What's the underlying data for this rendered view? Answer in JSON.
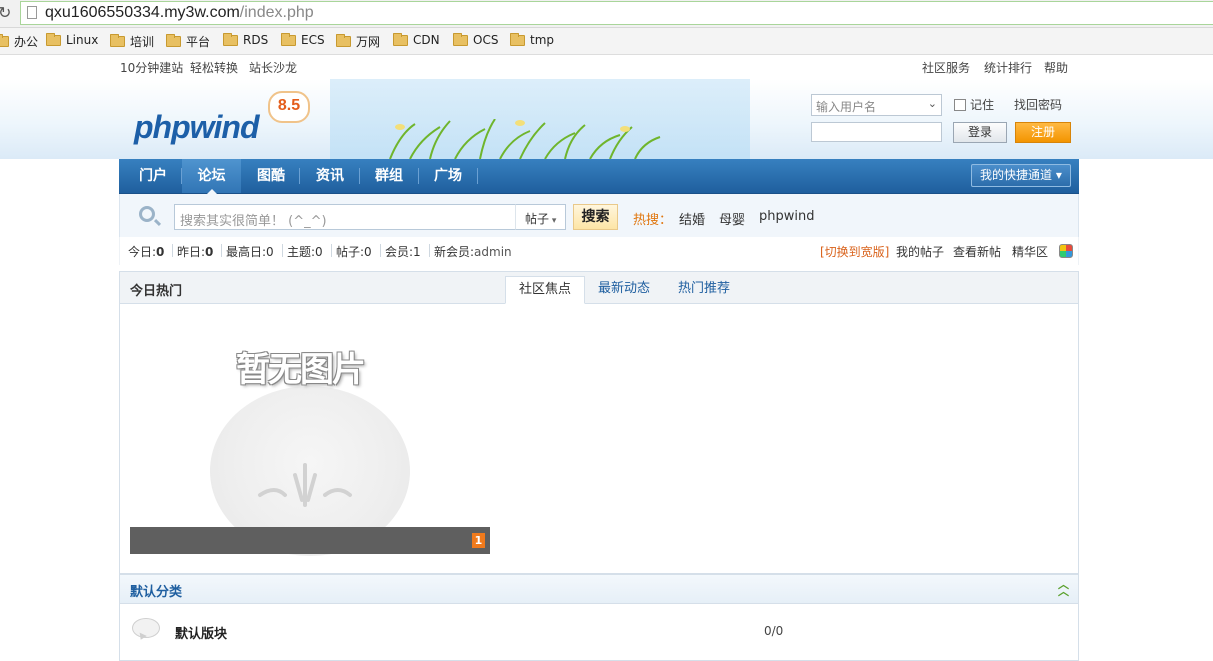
{
  "browser": {
    "url_host": "qxu1606550334.my3w.com",
    "url_path": "/index.php",
    "bookmarks": [
      "办公",
      "Linux",
      "培训",
      "平台",
      "RDS",
      "ECS",
      "万网",
      "CDN",
      "OCS",
      "tmp"
    ]
  },
  "toplinks": {
    "left": [
      "10分钟建站",
      "轻松转换",
      "站长沙龙"
    ],
    "right": [
      "社区服务",
      "统计排行",
      "帮助"
    ]
  },
  "header": {
    "logo": "phpwind",
    "version": "8.5",
    "login": {
      "user_placeholder": "输入用户名",
      "remember": "记住",
      "forgot": "找回密码",
      "login_btn": "登录",
      "register_btn": "注册"
    }
  },
  "nav": {
    "items": [
      "门户",
      "论坛",
      "图酷",
      "资讯",
      "群组",
      "广场"
    ],
    "active": "论坛",
    "quick": "我的快捷通道 ▾"
  },
  "search": {
    "placeholder": "搜索其实很简单！ (^_^)",
    "type": "帖子",
    "button": "搜索",
    "hot_label": "热搜：",
    "hot_items": [
      "结婚",
      "母婴",
      "phpwind"
    ]
  },
  "stats": {
    "today_label": "今日:",
    "today": "0",
    "yesterday_label": "昨日:",
    "yesterday": "0",
    "max_label": "最高日:",
    "max": "0",
    "topics_label": "主题:",
    "topics": "0",
    "posts_label": "帖子:",
    "posts": "0",
    "members_label": "会员:",
    "members": "1",
    "newest_label": "新会员:",
    "newest": "admin",
    "switch_wide": "[切换到宽版]",
    "my_posts": "我的帖子",
    "view_new": "查看新帖",
    "digest": "精华区"
  },
  "hot": {
    "title": "今日热门",
    "tabs": [
      "社区焦点",
      "最新动态",
      "热门推荐"
    ],
    "active_tab": "社区焦点",
    "placeholder_text": "暂无图片",
    "slide_index": "1"
  },
  "category": {
    "title": "默认分类",
    "forum_name": "默认版块",
    "forum_count": "0/0"
  }
}
